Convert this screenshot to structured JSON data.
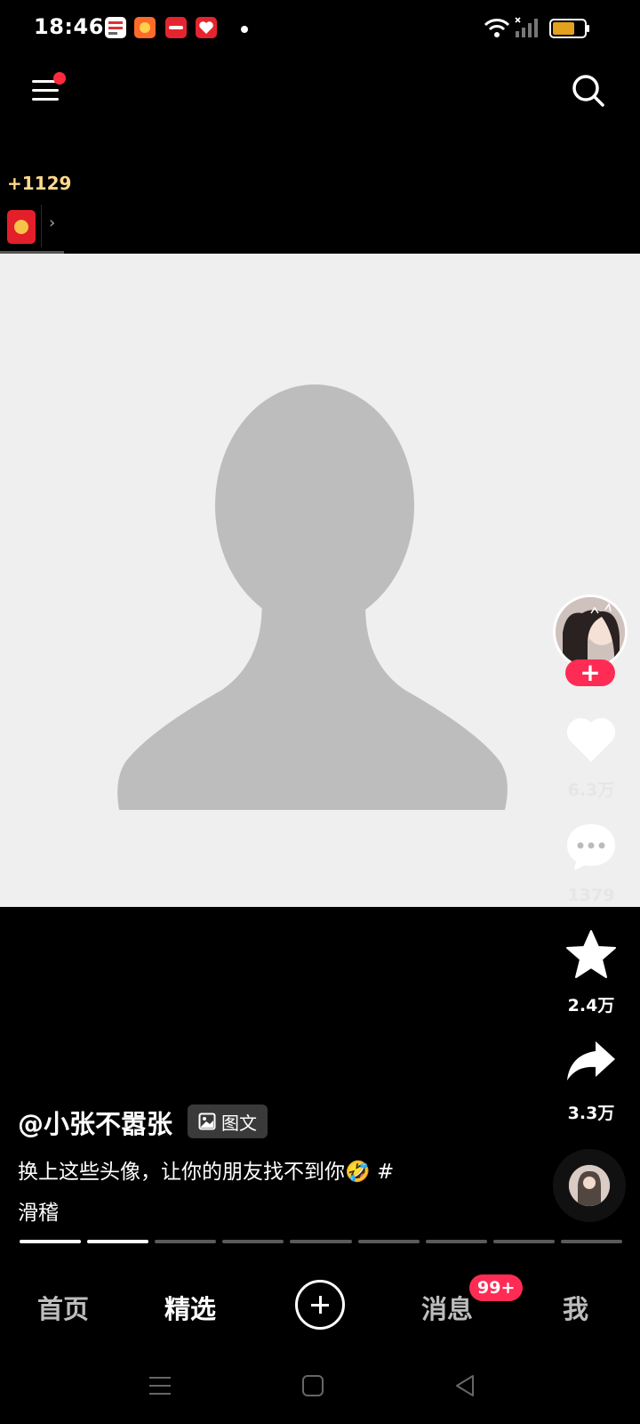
{
  "status_bar": {
    "time": "18:46",
    "app_icons": [
      "news-app-icon",
      "game-app-icon",
      "shopping-app-icon",
      "pinduoduo-app-icon"
    ],
    "icons": [
      "wifi-icon",
      "cellular-signal-icon",
      "battery-icon"
    ]
  },
  "top_bar": {
    "menu_icon": "menu-icon",
    "search_icon": "search-icon"
  },
  "reward": {
    "bonus": "+1129",
    "icon": "red-envelope-icon",
    "chevron": "›"
  },
  "post": {
    "author": "@小张不嚣张",
    "type_label": "图文",
    "caption_line1": "换上这些头像，让你的朋友找不到你🤣 #",
    "caption_line2": "滑稽"
  },
  "actions": {
    "likes": "6.3万",
    "comments": "1379",
    "favorites": "2.4万",
    "shares": "3.3万",
    "follow_symbol": "+"
  },
  "progress": {
    "total": 9,
    "completed": 2
  },
  "bottom_nav": {
    "home": "首页",
    "featured": "精选",
    "messages": "消息",
    "messages_badge": "99+",
    "me": "我",
    "active": "精选"
  },
  "colors": {
    "accent": "#fe2c55",
    "bonus": "#ffd98a",
    "background": "#000000",
    "media_background": "#efefef"
  }
}
